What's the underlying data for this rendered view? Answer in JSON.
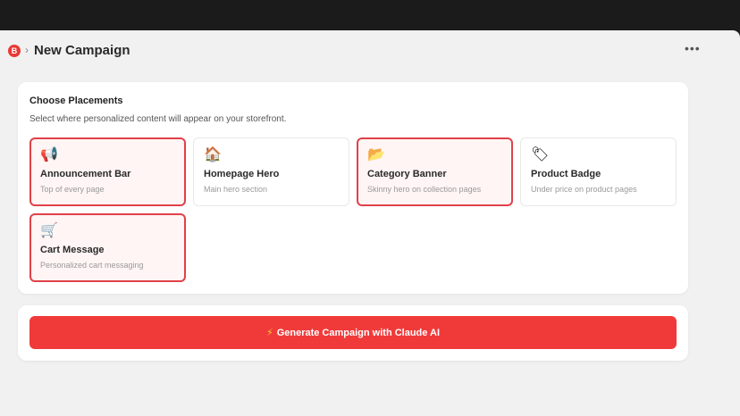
{
  "header": {
    "logo_text": "B",
    "breadcrumb_separator": "›",
    "title": "New Campaign",
    "more_label": "•••"
  },
  "placements": {
    "title": "Choose Placements",
    "subtitle": "Select where personalized content will appear on your storefront.",
    "items": [
      {
        "icon": "📢",
        "icon_name": "megaphone-icon",
        "name": "Announcement Bar",
        "description": "Top of every page",
        "selected": true
      },
      {
        "icon": "🏠",
        "icon_name": "house-icon",
        "name": "Homepage Hero",
        "description": "Main hero section",
        "selected": false
      },
      {
        "icon": "📂",
        "icon_name": "folder-icon",
        "name": "Category Banner",
        "description": "Skinny hero on collection pages",
        "selected": true
      },
      {
        "icon": "🏷",
        "icon_name": "tag-icon",
        "name": "Product Badge",
        "description": "Under price on product pages",
        "selected": false
      },
      {
        "icon": "🛒",
        "icon_name": "cart-icon",
        "name": "Cart Message",
        "description": "Personalized cart messaging",
        "selected": true
      }
    ]
  },
  "generate": {
    "icon": "⚡",
    "label": "Generate Campaign with Claude AI"
  },
  "colors": {
    "accent": "#f03a3a",
    "selected_border": "#e0414a",
    "selected_bg": "#fff5f4",
    "page_bg": "#f1f1f1"
  }
}
